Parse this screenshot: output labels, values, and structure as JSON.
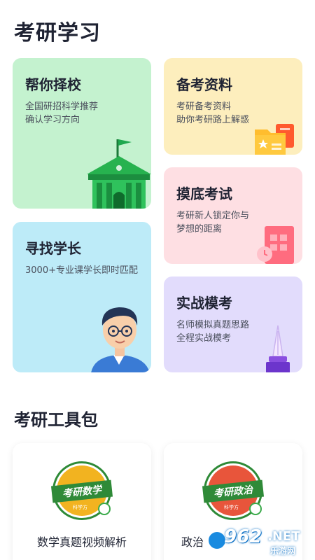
{
  "header": {
    "title": "考研学习"
  },
  "cards": {
    "school": {
      "title": "帮你择校",
      "desc": "全国研招科学推荐\n确认学习方向",
      "illustration": "school-building-icon"
    },
    "material": {
      "title": "备考资料",
      "desc": "考研备考资料\n助你考研路上解惑",
      "illustration": "folder-icon"
    },
    "mock": {
      "title": "摸底考试",
      "desc": "考研新人锁定你与\n梦想的距离",
      "illustration": "calendar-clock-icon"
    },
    "senior": {
      "title": "寻找学长",
      "desc": "3000+专业课学长即时匹配",
      "illustration": "student-avatar-icon"
    },
    "practice": {
      "title": "实战模考",
      "desc": "名师模拟真题思路\n全程实战模考",
      "illustration": "pen-icon"
    }
  },
  "tools": {
    "title": "考研工具包",
    "items": [
      {
        "logo_text": "考研数学",
        "logo_sub": "科学方",
        "name": "数学真题视频解析",
        "color": "#f2b320"
      },
      {
        "logo_text": "考研政治",
        "logo_sub": "科学方",
        "name": "政治",
        "color": "#e8553b"
      }
    ]
  },
  "watermark": {
    "number": "962",
    "suffix": ".NET",
    "chinese": "乐游网"
  },
  "colors": {
    "school_bg": "#c4f2cf",
    "senior_bg": "#bdebf8",
    "material_bg": "#fdeebd",
    "mock_bg": "#fedfe3",
    "practice_bg": "#e2dcfc"
  }
}
